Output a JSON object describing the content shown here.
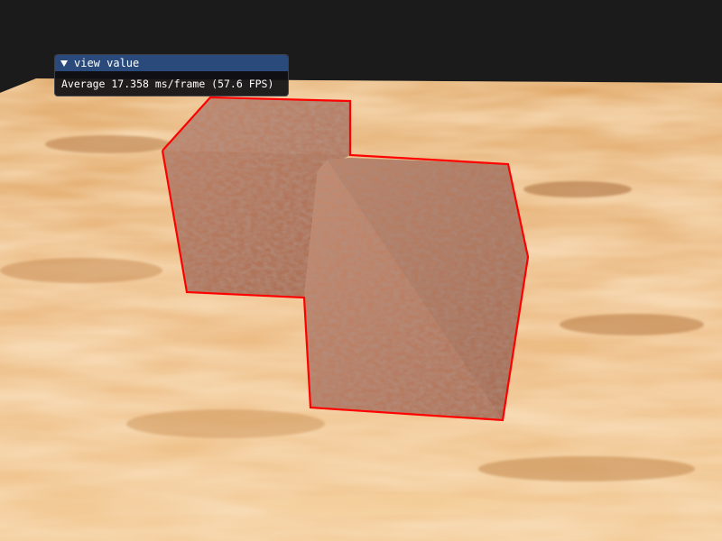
{
  "scene": {
    "background_color": "#1b1b1b",
    "floor_texture": "wood",
    "floor_colors": [
      "#f0c088",
      "#e0a868",
      "#c88a50",
      "#a86a38",
      "#fad7a5"
    ],
    "box_texture": "brick",
    "box_colors": [
      "#b97a5c",
      "#a46a50",
      "#c89578",
      "#8f5c48"
    ],
    "outline_color": "#ff0000",
    "object_count": 2
  },
  "overlay": {
    "window_title": "view value",
    "collapse_icon": "triangle-down-icon",
    "stats_text": "Average 17.358 ms/frame (57.6 FPS)",
    "title_bar_color": "#294a7a",
    "window_bg_color": "#0f0f14"
  }
}
